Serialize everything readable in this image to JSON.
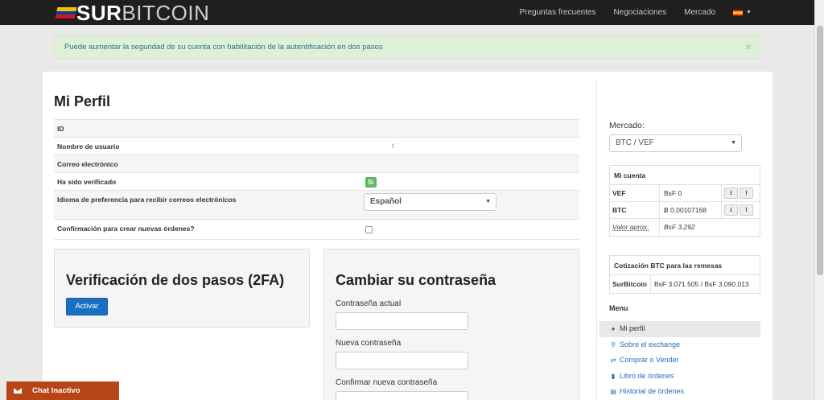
{
  "brand": {
    "strong": "SUR",
    "light": "BITCOIN",
    "flag_colors": [
      "#f2c200",
      "#0b3b9e",
      "#cf142b"
    ]
  },
  "nav": {
    "links": [
      "Preguntas frecuentes",
      "Negociaciones",
      "Mercado"
    ],
    "language_flag": "es"
  },
  "alert": {
    "text": "Puede aumentar la seguridad de su cuenta con habilitación de la autentificación en dos pasos",
    "close": "×"
  },
  "profile": {
    "title": "Mi Perfil",
    "rows": [
      {
        "label": "ID",
        "value": ""
      },
      {
        "label": "Nombre de usuario",
        "value": "t"
      },
      {
        "label": "Correo electrónico",
        "value": ""
      },
      {
        "label": "Ha sido verificado",
        "value": "Sí"
      },
      {
        "label": "Idioma de preferencia para recibir correos electrónicos",
        "value": "Español"
      },
      {
        "label": "Confirmación para crear nuevas órdenes?",
        "value": ""
      }
    ]
  },
  "two_factor": {
    "title": "Verificación de dos pasos (2FA)",
    "button": "Activar"
  },
  "password": {
    "title": "Cambiar su contraseña",
    "current_label": "Contraseña actual",
    "new_label": "Nueva contraseña",
    "confirm_label": "Confirmar nueva contraseña"
  },
  "sidebar": {
    "market_label": "Mercado:",
    "market_value": "BTC / VEF",
    "account": {
      "title": "Mi cuenta",
      "rows": [
        {
          "currency": "VEF",
          "amount": "BsF 0"
        },
        {
          "currency": "BTC",
          "amount": "Ƀ 0,00107168"
        }
      ],
      "approx_label": "Valor aprox.",
      "approx_value": "BsF 3.292"
    },
    "quote": {
      "title": "Cotización BTC para las remesas",
      "source": "SurBitcoin",
      "value": "BsF 3.071.505 / BsF 3.090.013"
    },
    "menu_title": "Menu",
    "menu": [
      {
        "icon": "user-icon",
        "label": "Mi perfil",
        "active": true
      },
      {
        "icon": "search-icon",
        "label": "Sobre el exchange"
      },
      {
        "icon": "shuffle-icon",
        "label": "Comprar o Vender"
      },
      {
        "icon": "book-icon",
        "label": "Libro de órdenes"
      },
      {
        "icon": "list-icon",
        "label": "Historial de órdenes"
      }
    ]
  },
  "chat": {
    "label": "Chat Inactivo"
  },
  "colors": {
    "navbar": "#1f1f1f",
    "primary": "#1a6fc5",
    "success": "#5cb85c",
    "chat": "#b84517",
    "link": "#2a6ebb"
  }
}
